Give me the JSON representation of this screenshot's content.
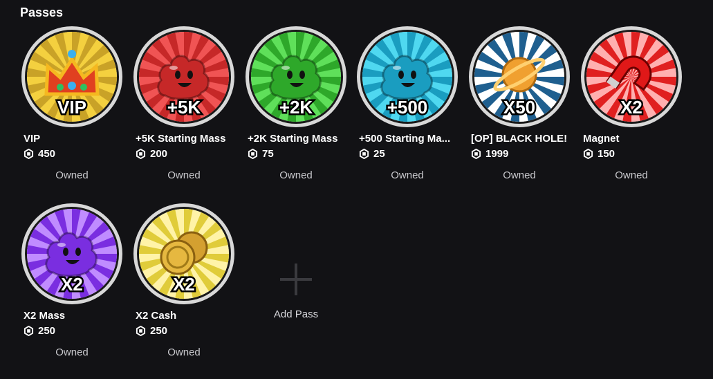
{
  "section": {
    "title": "Passes"
  },
  "passes": [
    {
      "name": "VIP",
      "price": "450",
      "status": "Owned",
      "badge": "VIP",
      "colors": [
        "#f4d03f",
        "#c9a227"
      ],
      "icon": "crown-icon"
    },
    {
      "name": "+5K Starting Mass",
      "price": "200",
      "status": "Owned",
      "badge": "+5K",
      "colors": [
        "#f05454",
        "#c62828"
      ],
      "icon": "blob-icon"
    },
    {
      "name": "+2K Starting Mass",
      "price": "75",
      "status": "Owned",
      "badge": "+2K",
      "colors": [
        "#5fe05a",
        "#2ea82a"
      ],
      "icon": "blob-icon"
    },
    {
      "name": "+500 Starting Ma...",
      "price": "25",
      "status": "Owned",
      "badge": "+500",
      "colors": [
        "#4fd8f0",
        "#1a9dc0"
      ],
      "icon": "blob-icon"
    },
    {
      "name": "[OP] BLACK HOLE!",
      "price": "1999",
      "status": "Owned",
      "badge": "X50",
      "colors": [
        "#ffffff",
        "#1f5f8f"
      ],
      "icon": "planet-icon"
    },
    {
      "name": "Magnet",
      "price": "150",
      "status": "Owned",
      "badge": "X2",
      "colors": [
        "#ffb0b0",
        "#e02020"
      ],
      "icon": "magnet-icon"
    },
    {
      "name": "X2 Mass",
      "price": "250",
      "status": "Owned",
      "badge": "X2",
      "colors": [
        "#c08cff",
        "#7a2ee0"
      ],
      "icon": "blob-icon"
    },
    {
      "name": "X2 Cash",
      "price": "250",
      "status": "Owned",
      "badge": "X2",
      "colors": [
        "#fff3a8",
        "#e0cc3a"
      ],
      "icon": "coins-icon"
    }
  ],
  "add_pass": {
    "label": "Add Pass"
  }
}
